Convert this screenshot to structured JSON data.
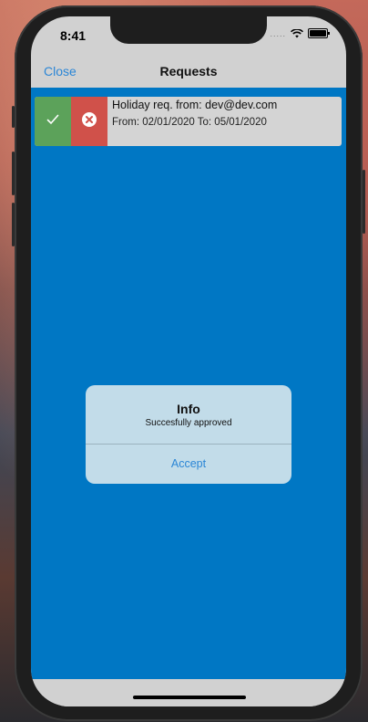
{
  "status_bar": {
    "time": "8:41",
    "signal": "....."
  },
  "nav": {
    "close_label": "Close",
    "title": "Requests"
  },
  "request": {
    "title": "Holiday req. from: dev@dev.com",
    "dates": "From: 02/01/2020 To: 05/01/2020"
  },
  "alert": {
    "title": "Info",
    "message": "Succesfully approved",
    "accept_label": "Accept"
  },
  "colors": {
    "content_bg": "#0077c4",
    "approve": "#5ca25a",
    "reject": "#d0514a",
    "link": "#2b86d6",
    "alert_bg": "#c2dce9"
  }
}
